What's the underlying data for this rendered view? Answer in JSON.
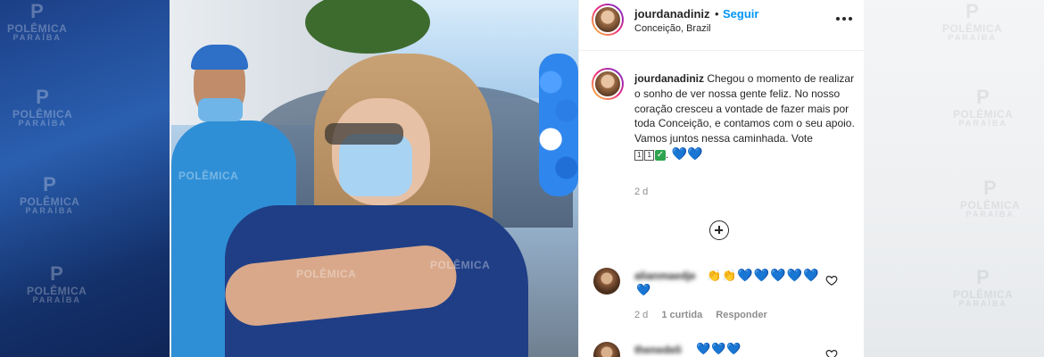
{
  "watermark": {
    "line1": "POLÊMICA",
    "line2": "PARAÍBA",
    "glyph": "P"
  },
  "post": {
    "username": "jourdanadiniz",
    "follow_label": "Seguir",
    "separator": "•",
    "location": "Conceição, Brazil",
    "more_icon": "more-options-icon"
  },
  "caption": {
    "username": "jourdanadiniz",
    "text": "Chegou o momento de realizar o sonho de ver nossa gente feliz. No nosso coração cresceu a vontade de fazer mais por toda Conceição, e contamos com o seu apoio. Vamos juntos nessa caminhada. Vote",
    "vote_digits": [
      "1",
      "1"
    ],
    "check": "✓",
    "end": ".",
    "hearts": "💙💙",
    "time": "2 d"
  },
  "load_more_icon": "plus-circle-icon",
  "comments": [
    {
      "username": "alianmaedje",
      "claps": "👏👏",
      "hearts": "💙💙💙💙💙",
      "hearts_wrap": "💙",
      "time": "2 d",
      "likes": "1 curtida",
      "reply": "Responder"
    },
    {
      "username": "thenedeli",
      "hearts": "💙💙💙"
    }
  ],
  "colors": {
    "accent": "#0095f6",
    "heart": "#1d7ee8",
    "text": "#262626",
    "muted": "#8e8e8e"
  }
}
